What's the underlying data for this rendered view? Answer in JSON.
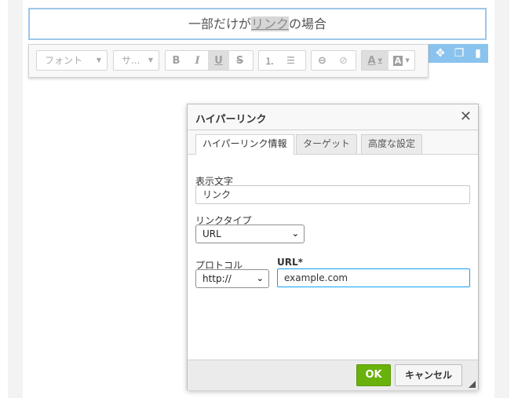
{
  "editor": {
    "text_before": "一部だけが",
    "link_text": "リンク",
    "text_after": "の場合"
  },
  "toolbar": {
    "font_combo": "フォント",
    "size_combo": "サ...",
    "bold": "B",
    "italic": "I",
    "underline": "U",
    "strike": "S",
    "numbered_list": "⒈",
    "bulleted_list": "☰",
    "text_color": "A",
    "bg_color": "A"
  },
  "dialog": {
    "title": "ハイパーリンク",
    "close": "✕",
    "tabs": [
      {
        "label": "ハイパーリンク情報"
      },
      {
        "label": "ターゲット"
      },
      {
        "label": "高度な設定"
      }
    ],
    "display_text_label": "表示文字",
    "display_text_value": "リンク",
    "link_type_label": "リンクタイプ",
    "link_type_value": "URL",
    "protocol_label": "プロトコル",
    "protocol_value": "http://",
    "url_label": "URL*",
    "url_value": "example.com",
    "ok_label": "OK",
    "cancel_label": "キャンセル"
  }
}
